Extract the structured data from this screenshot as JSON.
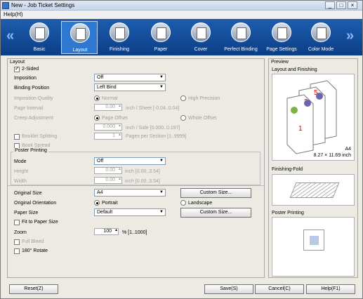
{
  "window": {
    "title": "New - Job Ticket Settings",
    "menu": "Help(H)",
    "buttons": [
      "_",
      "□",
      "×"
    ]
  },
  "toolbar": {
    "left_arrow": "«",
    "right_arrow": "»",
    "items": [
      {
        "label": "Basic",
        "icon": "basic-icon"
      },
      {
        "label": "Layout",
        "icon": "layout-icon",
        "active": true
      },
      {
        "label": "Finishing",
        "icon": "finishing-icon"
      },
      {
        "label": "Paper",
        "icon": "paper-icon"
      },
      {
        "label": "Cover",
        "icon": "cover-icon"
      },
      {
        "label": "Perfect Binding",
        "icon": "perfect-binding-icon"
      },
      {
        "label": "Page Settings",
        "icon": "page-settings-icon"
      },
      {
        "label": "Color Mode",
        "icon": "color-mode-icon"
      }
    ]
  },
  "layout": {
    "group_title": "Layout",
    "two_sided": "2-Sided",
    "imposition_label": "Imposition",
    "imposition_value": "Off",
    "binding_position_label": "Binding Position",
    "binding_position_value": "Left Bind",
    "imposition_quality_label": "Imposition Quality",
    "normal": "Normal",
    "high_precision": "High Precision",
    "page_interval_label": "Page Interval",
    "page_interval_value": "0.00",
    "page_interval_unit": "inch / Sheet [-0.04..0.04]",
    "creep_adjustment_label": "Creep Adjustment",
    "page_offset": "Page Offset",
    "whole_offset": "Whole Offset",
    "creep_value": "0.000",
    "creep_unit": "inch / Side [0.000..0.197]",
    "booklet_splitting": "Booklet Splitting",
    "booklet_value": "1",
    "booklet_unit": "Pages per Section [1..9999]",
    "book_spread": "Book Spread"
  },
  "poster": {
    "group_title": "Poster Printing",
    "mode_label": "Mode",
    "mode_value": "Off",
    "height_label": "Height",
    "height_value": "0.00",
    "height_unit": "inch [0.00..3.54]",
    "width_label": "Width",
    "width_value": "0.00",
    "width_unit": "inch [0.00..3.54]"
  },
  "page": {
    "original_size_label": "Original Size",
    "original_size_value": "A4",
    "custom_size": "Custom Size...",
    "orientation_label": "Original Orientation",
    "portrait": "Portrait",
    "landscape": "Landscape",
    "paper_size_label": "Paper Size",
    "paper_size_value": "Default",
    "custom_size2": "Custom Size...",
    "fit_to_paper_size": "Fit to Paper Size",
    "zoom_label": "Zoom",
    "zoom_value": "100",
    "zoom_unit": "% [1..1000]",
    "full_bleed": "Full Bleed",
    "rotate": "180°    Rotate"
  },
  "preview": {
    "title": "Preview",
    "layout_finishing": "Layout and Finishing",
    "paper_name": "A4",
    "paper_dims": "8.27 × 11.69 inch",
    "finishing_fold": "Finishing-Fold",
    "poster_printing": "Poster Printing"
  },
  "footer": {
    "reset": "Reset(Z)",
    "save": "Save(S)",
    "cancel": "Cancel(C)",
    "help": "Help(F1)"
  },
  "colors": {
    "toolbar": "#0c3e86",
    "active_tool": "#2f78d1"
  }
}
